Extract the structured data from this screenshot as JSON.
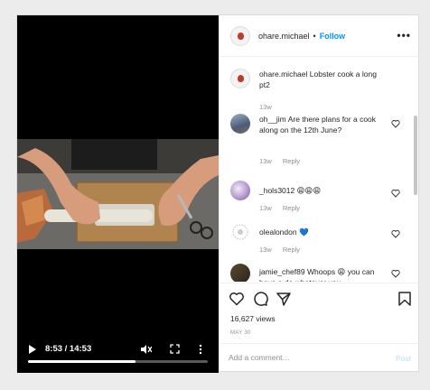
{
  "video": {
    "time": "8:53 / 14:53",
    "progress": 0.597
  },
  "header": {
    "username": "ohare.michael",
    "dot": "•",
    "follow_label": "Follow",
    "more_icon": "more-horizontal-icon"
  },
  "caption": {
    "username": "ohare.michael",
    "text": "Lobster cook a long pt2",
    "age": "13w"
  },
  "comments": [
    {
      "username": "oh__jim",
      "text": "Are there plans for a cook along on the 12th June?",
      "age": "13w",
      "reply": "Reply"
    },
    {
      "username": "_hols3012",
      "text": "😩😩😩",
      "age": "13w",
      "reply": "Reply"
    },
    {
      "username": "olealondon",
      "text": "💙",
      "age": "13w",
      "reply": "Reply"
    },
    {
      "username": "jamie_chef89",
      "text": "Whoops 😩 you can have a do whatever you",
      "age": "",
      "reply": ""
    }
  ],
  "stats": {
    "views": "16,627 views",
    "date": "MAY 30"
  },
  "add_comment": {
    "placeholder": "Add a comment…",
    "post_label": "Post"
  },
  "colors": {
    "accent": "#0095f6",
    "post_disabled": "#b2dffc",
    "muted": "#8e8e8e"
  }
}
